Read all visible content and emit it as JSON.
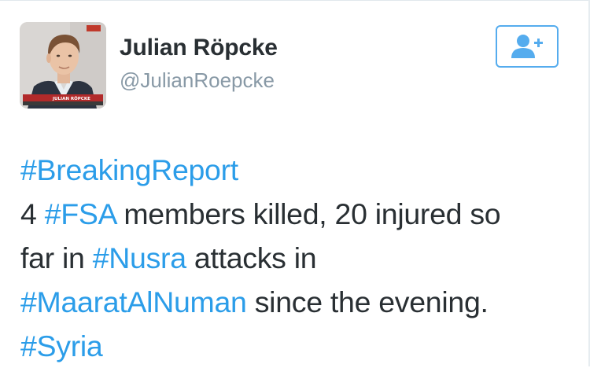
{
  "author": {
    "name": "Julian Röpcke",
    "handle": "@JulianRoepcke",
    "avatar_caption": "JULIAN RÖPCKE"
  },
  "follow_button": {
    "icon": "add-user-icon"
  },
  "tweet": {
    "lines": [
      [
        {
          "text": "#BreakingReport",
          "hashtag": true
        }
      ],
      [
        {
          "text": "4 ",
          "hashtag": false
        },
        {
          "text": "#FSA",
          "hashtag": true
        },
        {
          "text": " members killed, 20 injured so",
          "hashtag": false
        }
      ],
      [
        {
          "text": "far in ",
          "hashtag": false
        },
        {
          "text": "#Nusra",
          "hashtag": true
        },
        {
          "text": " attacks in",
          "hashtag": false
        }
      ],
      [
        {
          "text": "#MaaratAlNuman",
          "hashtag": true
        },
        {
          "text": " since the evening.",
          "hashtag": false
        }
      ],
      [
        {
          "text": "#Syria",
          "hashtag": true
        }
      ]
    ]
  },
  "colors": {
    "hashtag": "#2b9de9",
    "name": "#292f33",
    "handle": "#8899a6",
    "accent": "#55acee"
  }
}
